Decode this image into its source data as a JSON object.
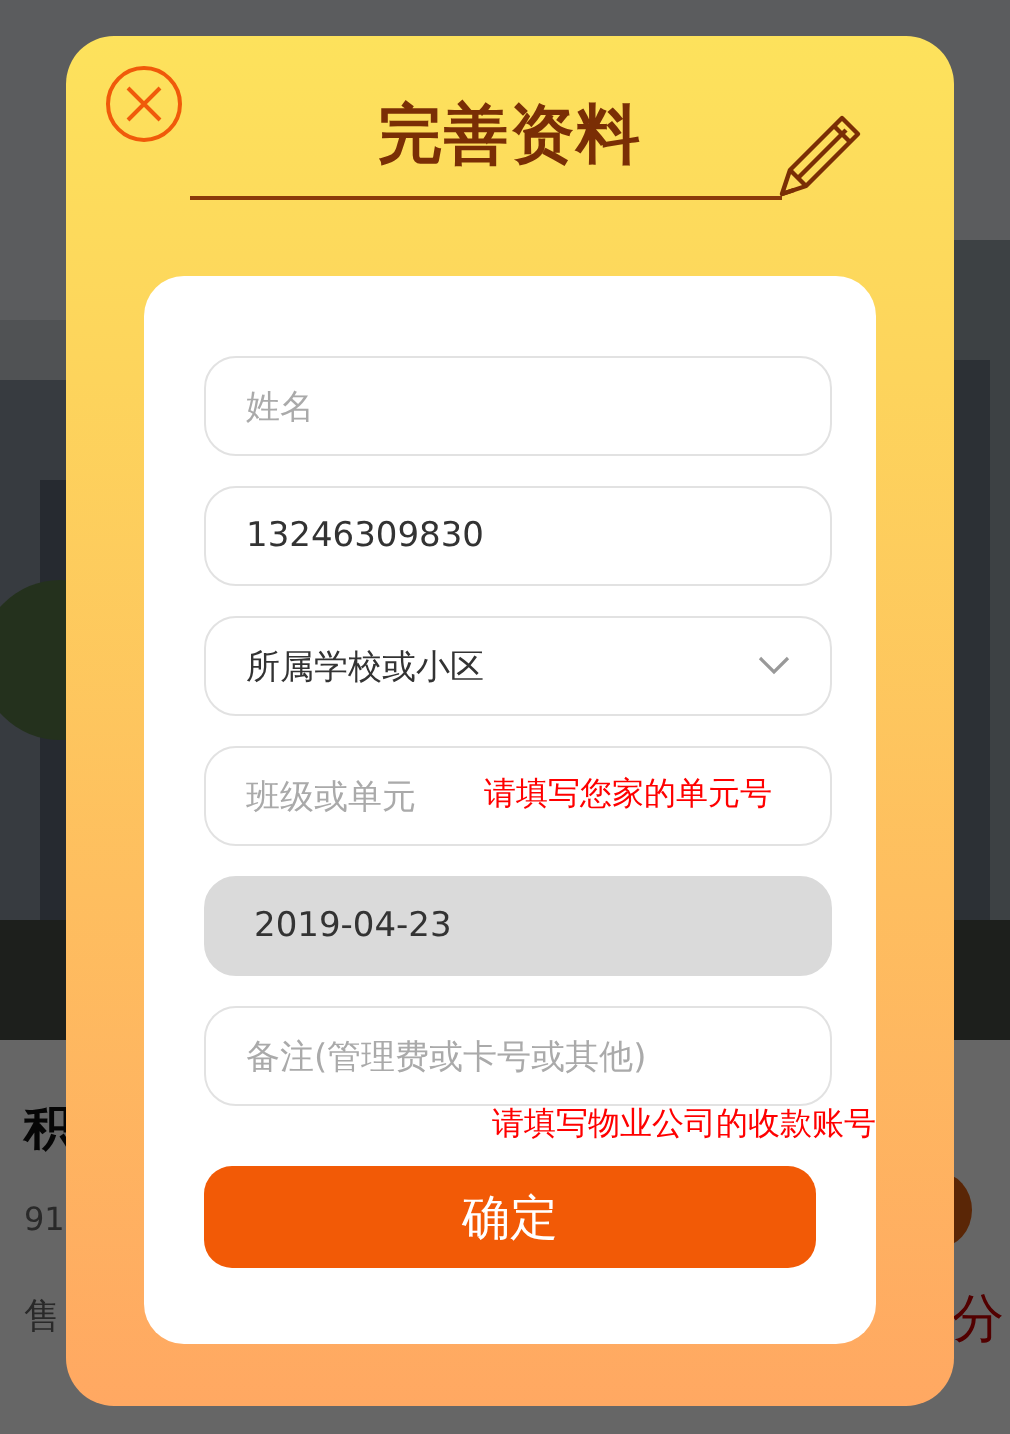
{
  "background": {
    "heading": "积",
    "line_1": "91",
    "line_2": "售",
    "price_unit": "分"
  },
  "dialog": {
    "title": "完善资料",
    "fields": [
      {
        "kind": "input",
        "placeholder": "姓名"
      },
      {
        "kind": "input",
        "value": "13246309830"
      },
      {
        "kind": "select",
        "placeholder": "所属学校或小区"
      },
      {
        "kind": "input",
        "placeholder": "班级或单元",
        "note": "请填写您家的单元号"
      },
      {
        "kind": "date",
        "value": "2019-04-23"
      },
      {
        "kind": "input",
        "placeholder": "备注(管理费或卡号或其他)"
      },
      {
        "kind": "hint",
        "text": "请填写物业公司的收款账号"
      }
    ],
    "submit": "确定"
  }
}
